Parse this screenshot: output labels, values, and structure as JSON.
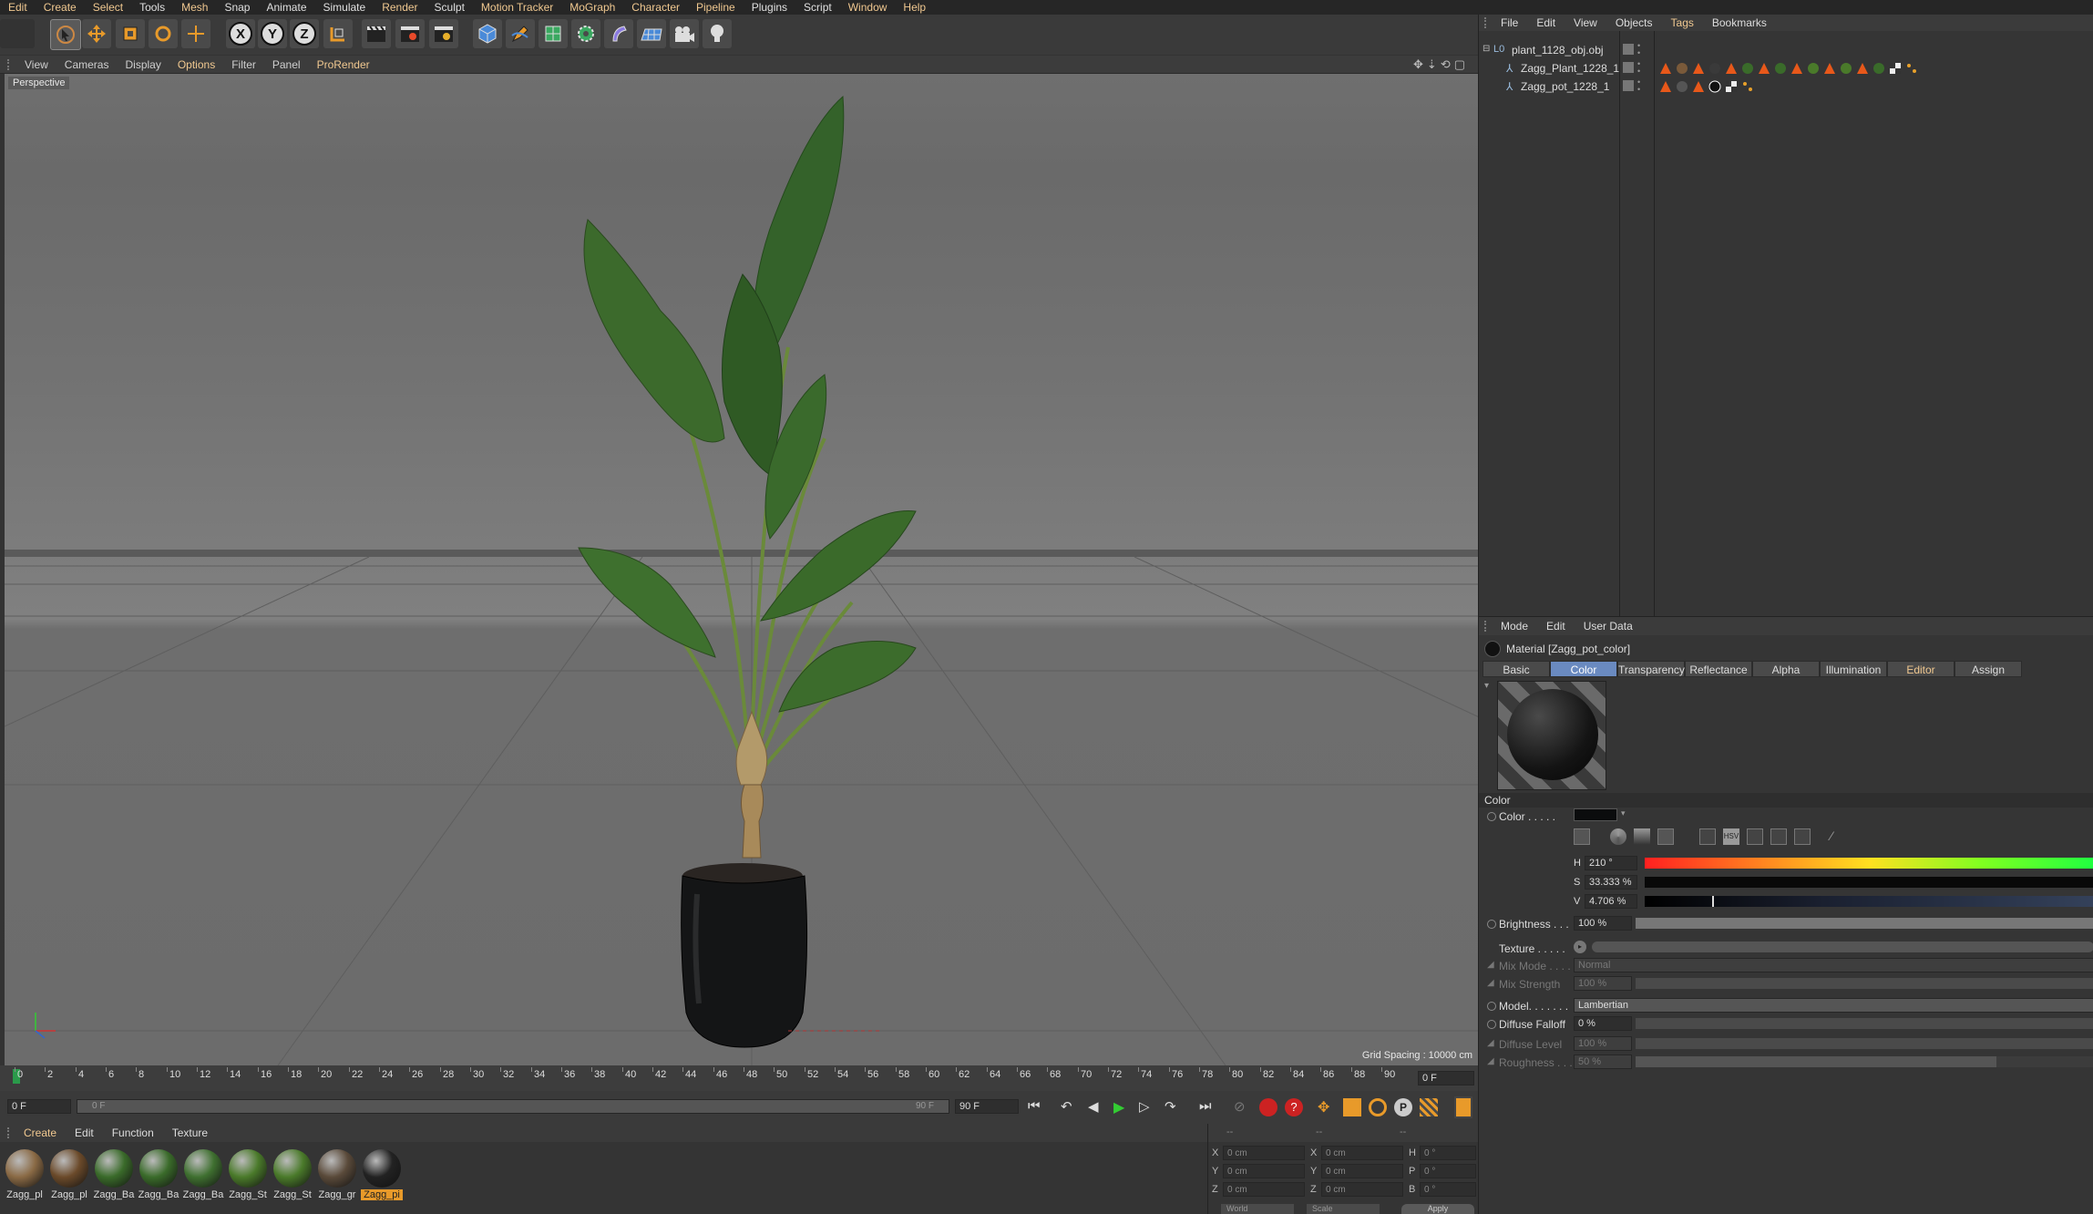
{
  "menubar": {
    "items": [
      "Edit",
      "Create",
      "Select",
      "Tools",
      "Mesh",
      "Snap",
      "Animate",
      "Simulate",
      "Render",
      "Sculpt",
      "Motion Tracker",
      "MoGraph",
      "Character",
      "Pipeline",
      "Plugins",
      "Script",
      "Window",
      "Help"
    ]
  },
  "toolbar": {
    "x_label": "X",
    "y_label": "Y",
    "z_label": "Z"
  },
  "viewport": {
    "menu": [
      "View",
      "Cameras",
      "Display",
      "Options",
      "Filter",
      "Panel",
      "ProRender"
    ],
    "label": "Perspective",
    "grid_spacing": "Grid Spacing : 10000 cm"
  },
  "timeline": {
    "ticks": [
      "0",
      "2",
      "4",
      "6",
      "8",
      "10",
      "12",
      "14",
      "16",
      "18",
      "20",
      "22",
      "24",
      "26",
      "28",
      "30",
      "32",
      "34",
      "36",
      "38",
      "40",
      "42",
      "44",
      "46",
      "48",
      "50",
      "52",
      "54",
      "56",
      "58",
      "60",
      "62",
      "64",
      "66",
      "68",
      "70",
      "72",
      "74",
      "76",
      "78",
      "80",
      "82",
      "84",
      "86",
      "88",
      "90"
    ],
    "current_frame": "0 F",
    "start_field": "0 F",
    "range_start": "0 F",
    "range_end": "90 F",
    "end_field": "90 F"
  },
  "material_manager": {
    "menu": [
      "Create",
      "Edit",
      "Function",
      "Texture"
    ],
    "materials": [
      {
        "name": "Zagg_pl",
        "color": "#8a6a45"
      },
      {
        "name": "Zagg_pl",
        "color": "#6b4a2a"
      },
      {
        "name": "Zagg_Ba",
        "color": "#3a6b2a"
      },
      {
        "name": "Zagg_Ba",
        "color": "#3a6b2a"
      },
      {
        "name": "Zagg_Ba",
        "color": "#3f7030"
      },
      {
        "name": "Zagg_St",
        "color": "#4a7a2a"
      },
      {
        "name": "Zagg_St",
        "color": "#4a7a2a"
      },
      {
        "name": "Zagg_gr",
        "color": "#5a4a3a"
      },
      {
        "name": "Zagg_pi",
        "color": "#222222",
        "selected": true
      }
    ]
  },
  "coords": {
    "header": [
      "--",
      "--",
      "--"
    ],
    "rows": [
      {
        "a": "X",
        "a_val": "0 cm",
        "b": "X",
        "b_val": "0 cm",
        "c": "H",
        "c_val": "0 °"
      },
      {
        "a": "Y",
        "a_val": "0 cm",
        "b": "Y",
        "b_val": "0 cm",
        "c": "P",
        "c_val": "0 °"
      },
      {
        "a": "Z",
        "a_val": "0 cm",
        "b": "Z",
        "b_val": "0 cm",
        "c": "B",
        "c_val": "0 °"
      }
    ],
    "world": "World",
    "scale": "Scale",
    "apply": "Apply"
  },
  "object_manager": {
    "menu": [
      "File",
      "Edit",
      "View",
      "Objects",
      "Tags",
      "Bookmarks"
    ],
    "objects": [
      {
        "name": "plant_1128_obj.obj"
      },
      {
        "name": "Zagg_Plant_1228_1"
      },
      {
        "name": "Zagg_pot_1228_1"
      }
    ]
  },
  "attributes": {
    "menu": [
      "Mode",
      "Edit",
      "User Data"
    ],
    "title": "Material [Zagg_pot_color]",
    "tabs": [
      "Basic",
      "Color",
      "Transparency",
      "Reflectance",
      "Alpha",
      "Illumination",
      "Editor",
      "Assign"
    ],
    "section": "Color",
    "color_label": "Color . . . . .",
    "h_label": "H",
    "h_val": "210 °",
    "s_label": "S",
    "s_val": "33.333 %",
    "v_label": "V",
    "v_val": "4.706 %",
    "brightness_label": "Brightness . . .",
    "brightness_val": "100 %",
    "texture_label": "Texture . . . . .",
    "mixmode_label": "Mix Mode . . . .",
    "mixmode_val": "Normal",
    "mixstrength_label": "Mix Strength",
    "mixstrength_val": "100 %",
    "model_label": "Model. . . . . . .",
    "model_val": "Lambertian",
    "falloff_label": "Diffuse Falloff",
    "falloff_val": "0 %",
    "level_label": "Diffuse Level",
    "level_val": "100 %",
    "rough_label": "Roughness . . .",
    "rough_val": "50 %"
  },
  "colors": {
    "accent": "#f0c890",
    "tab_active": "#6a8ac0",
    "pot_color": "#0b0c0d"
  }
}
